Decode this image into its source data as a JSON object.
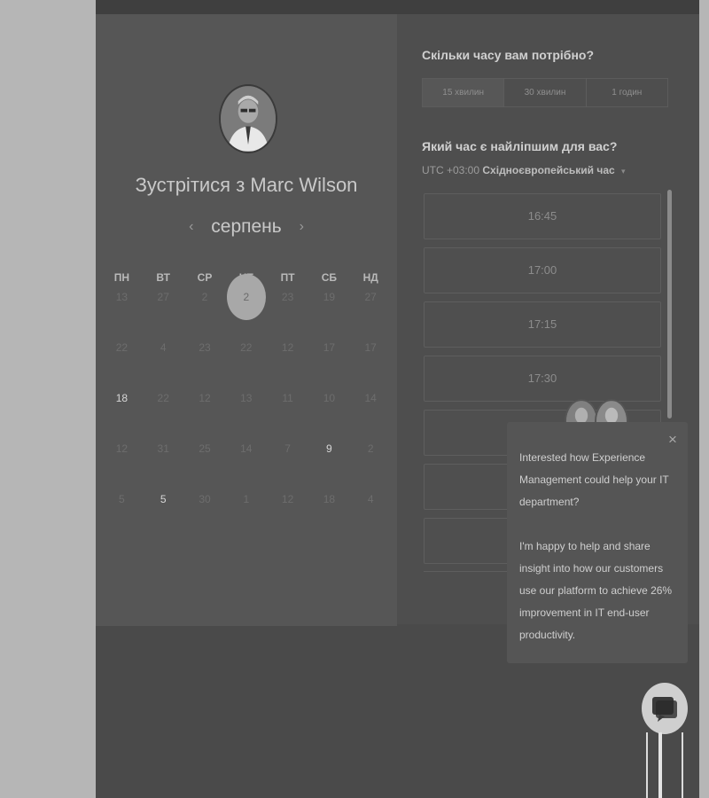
{
  "left": {
    "title": "Зустрітися з Marc Wilson",
    "month": "серпень",
    "prev_icon": "‹",
    "next_icon": "›",
    "weekdays": [
      "ПН",
      "ВТ",
      "СР",
      "ЧТ",
      "ПТ",
      "СБ",
      "НД"
    ],
    "weeks": [
      [
        {
          "d": "13"
        },
        {
          "d": "27"
        },
        {
          "d": "2"
        },
        {
          "d": "2",
          "selected": true
        },
        {
          "d": "23"
        },
        {
          "d": "19"
        },
        {
          "d": "27"
        }
      ],
      [
        {
          "d": "22"
        },
        {
          "d": "4"
        },
        {
          "d": "23"
        },
        {
          "d": "22"
        },
        {
          "d": "12"
        },
        {
          "d": "17"
        },
        {
          "d": "17"
        }
      ],
      [
        {
          "d": "18",
          "active": true
        },
        {
          "d": "22"
        },
        {
          "d": "12"
        },
        {
          "d": "13"
        },
        {
          "d": "11"
        },
        {
          "d": "10"
        },
        {
          "d": "14"
        }
      ],
      [
        {
          "d": "12"
        },
        {
          "d": "31"
        },
        {
          "d": "25"
        },
        {
          "d": "14"
        },
        {
          "d": "7"
        },
        {
          "d": "9",
          "active": true
        },
        {
          "d": "2"
        }
      ],
      [
        {
          "d": "5"
        },
        {
          "d": "5",
          "active": true
        },
        {
          "d": "30"
        },
        {
          "d": "1"
        },
        {
          "d": "12"
        },
        {
          "d": "18"
        },
        {
          "d": "4"
        }
      ]
    ]
  },
  "right": {
    "duration_question": "Скільки часу вам потрібно?",
    "durations": [
      "15 хвилин",
      "30 хвилин",
      "1 годин"
    ],
    "time_question": "Який час є найліпшим для вас?",
    "tz_offset": "UTC +03:00",
    "tz_name": "Східноєвропейський час",
    "tz_caret": "▾",
    "slots": [
      "16:45",
      "17:00",
      "17:15",
      "17:30",
      "",
      "",
      ""
    ]
  },
  "chat": {
    "close": "×",
    "message_lines_1": "Interested how Experience Management could help your IT department?",
    "message_lines_2": "I'm happy to help and share insight into how our customers use our platform to achieve 26% improvement in IT end-user productivity."
  }
}
